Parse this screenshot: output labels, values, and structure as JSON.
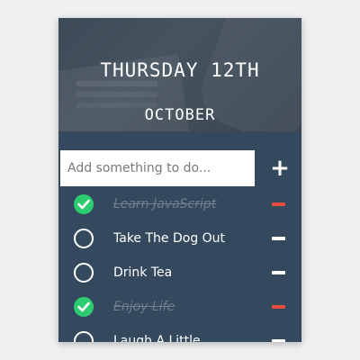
{
  "header": {
    "day": "THURSDAY 12TH",
    "month": "OCTOBER"
  },
  "add": {
    "placeholder": "Add something to do...",
    "button_label": "+"
  },
  "todos": [
    {
      "text": "Learn JavaScript",
      "done": true
    },
    {
      "text": "Take The Dog Out",
      "done": false
    },
    {
      "text": "Drink Tea",
      "done": false
    },
    {
      "text": "Enjoy Life",
      "done": true
    },
    {
      "text": "Laugh A Little",
      "done": false
    }
  ],
  "colors": {
    "card": "#34495e",
    "done_check": "#2ecc71",
    "remove_done": "#e74c3c",
    "done_text": "#6f7d8c"
  },
  "icons": {
    "check": "check-icon",
    "remove": "minus-icon",
    "add": "plus-icon"
  }
}
